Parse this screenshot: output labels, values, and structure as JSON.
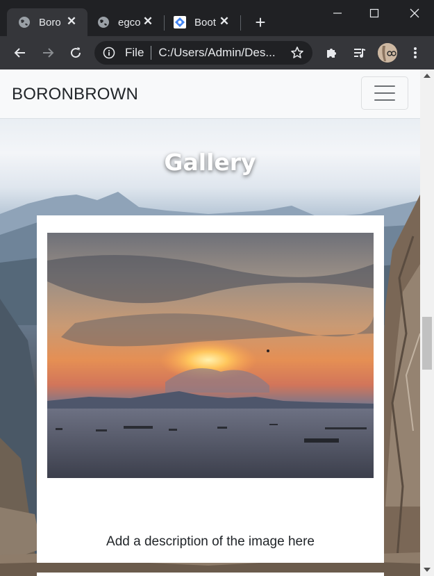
{
  "browser": {
    "tabs": [
      {
        "title": "Boro",
        "favicon": "globe-icon",
        "active": true
      },
      {
        "title": "egco",
        "favicon": "globe-icon",
        "active": false
      },
      {
        "title": "Boot",
        "favicon": "bootstrap-icon",
        "active": false
      }
    ],
    "omnibox": {
      "label": "File",
      "url": "C:/Users/Admin/Des..."
    }
  },
  "navbar": {
    "brand": "BORONBROWN"
  },
  "page": {
    "heading": "Gallery",
    "card": {
      "image": "sunset-over-sea-photo",
      "description": "Add a description of the image here"
    }
  },
  "colors": {
    "chrome_dark": "#202124",
    "chrome_toolbar": "#35363a",
    "navbar_bg": "#f8f9fa",
    "text_dark": "#212529"
  }
}
